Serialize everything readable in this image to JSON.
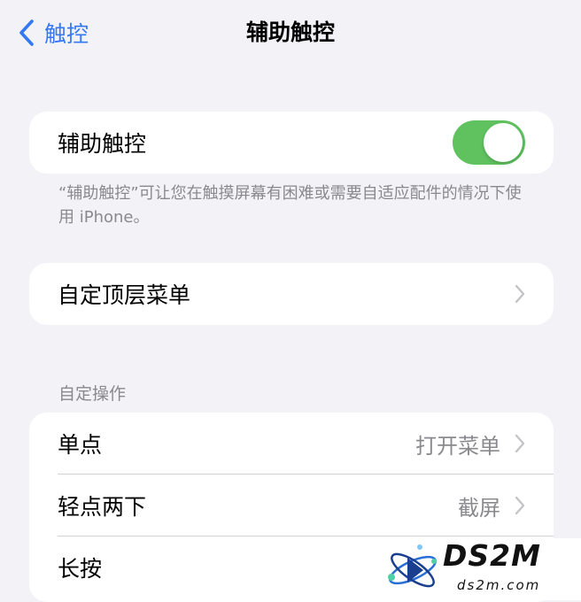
{
  "nav": {
    "back_label": "触控",
    "title": "辅助触控"
  },
  "assistive_touch": {
    "label": "辅助触控",
    "enabled": true,
    "toggle_color": "#5fc25f"
  },
  "footnote": "“辅助触控”可让您在触摸屏幕有困难或需要自适应配件的情况下使用 iPhone。",
  "top_menu": {
    "label": "自定顶层菜单"
  },
  "custom_actions": {
    "header": "自定操作",
    "rows": [
      {
        "label": "单点",
        "value": "打开菜单"
      },
      {
        "label": "轻点两下",
        "value": "截屏"
      },
      {
        "label": "长按",
        "value": ""
      }
    ]
  },
  "watermark": {
    "brand": "DS2M",
    "url": "ds2m.com"
  },
  "colors": {
    "accent": "#3478f6",
    "background": "#f2f2f7",
    "secondary_text": "#8a8a8e"
  },
  "icons": [
    "chevron-left-icon",
    "chevron-right-icon",
    "atom-logo-icon"
  ]
}
